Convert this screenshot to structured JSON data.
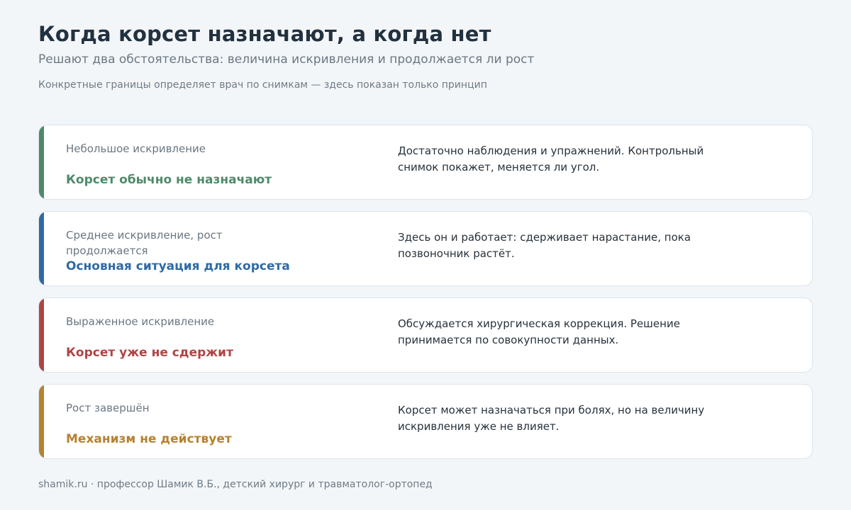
{
  "header": {
    "title": "Когда корсет назначают, а когда нет",
    "subtitle": "Решают два обстоятельства: величина искривления и продолжается ли рост",
    "note": "Конкретные границы определяет врач по снимкам — здесь показан только принцип"
  },
  "cards": [
    {
      "condition": "Небольшое искривление",
      "verdict": "Корсет обычно не назначают",
      "description": "Достаточно наблюдения и упражнений. Контрольный снимок покажет, меняется ли угол.",
      "color": "#4e8a6a"
    },
    {
      "condition": "Среднее искривление, рост продолжается",
      "verdict": "Основная ситуация для корсета",
      "description": "Здесь он и работает: сдерживает нарастание, пока позвоночник растёт.",
      "color": "#2f6aa6"
    },
    {
      "condition": "Выраженное искривление",
      "verdict": "Корсет уже не сдержит",
      "description": "Обсуждается хирургическая коррекция. Решение принимается по совокупности данных.",
      "color": "#b04444"
    },
    {
      "condition": "Рост завершён",
      "verdict": "Механизм не действует",
      "description": "Корсет может назначаться при болях, но на величину искривления уже не влияет.",
      "color": "#b58230"
    }
  ],
  "footer": {
    "text": "shamik.ru · профессор Шамик В.Б., детский хирург и травматолог-ортопед"
  }
}
